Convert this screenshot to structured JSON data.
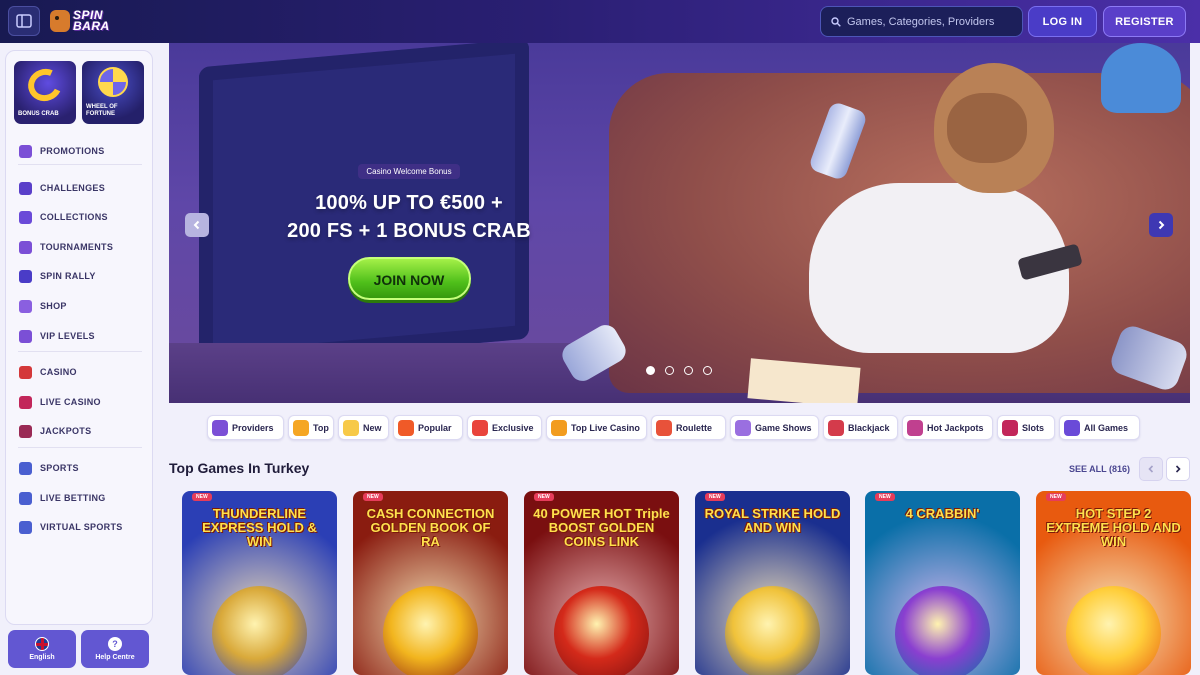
{
  "header": {
    "logo_text_1": "SPIN",
    "logo_text_2": "BARA",
    "search_placeholder": "Games, Categories, Providers",
    "login_label": "LOG IN",
    "register_label": "REGISTER"
  },
  "sidebar": {
    "tiles": [
      {
        "label": "BONUS CRAB"
      },
      {
        "label": "WHEEL OF FORTUNE"
      }
    ],
    "items": [
      {
        "label": "PROMOTIONS",
        "icon": "gift-icon"
      },
      {
        "label": "CHALLENGES",
        "icon": "trophy-icon"
      },
      {
        "label": "COLLECTIONS",
        "icon": "collection-icon"
      },
      {
        "label": "TOURNAMENTS",
        "icon": "tournament-icon"
      },
      {
        "label": "SPIN RALLY",
        "icon": "flag-icon"
      },
      {
        "label": "SHOP",
        "icon": "shop-icon"
      },
      {
        "label": "VIP LEVELS",
        "icon": "crown-icon"
      },
      {
        "label": "CASINO",
        "icon": "slot-icon"
      },
      {
        "label": "LIVE CASINO",
        "icon": "roulette-icon"
      },
      {
        "label": "JACKPOTS",
        "icon": "jackpot-icon"
      },
      {
        "label": "SPORTS",
        "icon": "ball-icon"
      },
      {
        "label": "LIVE BETTING",
        "icon": "live-icon"
      },
      {
        "label": "VIRTUAL SPORTS",
        "icon": "virtual-icon"
      }
    ],
    "language_label": "English",
    "help_label": "Help Centre"
  },
  "hero": {
    "badge": "Casino Welcome Bonus",
    "title_line1": "100% UP TO €500 +",
    "title_line2": "200 FS + 1 BONUS CRAB",
    "cta": "JOIN NOW",
    "slide_count": 4,
    "active_slide": 1
  },
  "categories": [
    {
      "label": "Providers",
      "color": "#7b4fd6"
    },
    {
      "label": "Top",
      "color": "#f5a623"
    },
    {
      "label": "New",
      "color": "#f7c948"
    },
    {
      "label": "Popular",
      "color": "#f05a28"
    },
    {
      "label": "Exclusive",
      "color": "#e9443c"
    },
    {
      "label": "Top Live Casino",
      "color": "#f29c1f"
    },
    {
      "label": "Roulette",
      "color": "#e8523a"
    },
    {
      "label": "Game Shows",
      "color": "#9a6fe0"
    },
    {
      "label": "Blackjack",
      "color": "#d43b4b"
    },
    {
      "label": "Hot Jackpots",
      "color": "#c0408f"
    },
    {
      "label": "Slots",
      "color": "#c2265a"
    },
    {
      "label": "All Games",
      "color": "#6a4ad8"
    }
  ],
  "section": {
    "title": "Top Games In Turkey",
    "see_all": "SEE ALL (816)"
  },
  "games": [
    {
      "title": "THUNDERLINE EXPRESS HOLD & WIN",
      "tag": "NEW",
      "bg": "#2b3fb5",
      "art": "#d9a93a"
    },
    {
      "title": "CASH CONNECTION GOLDEN BOOK OF RA",
      "tag": "NEW",
      "bg": "#8a1c10",
      "art": "#f2b51e"
    },
    {
      "title": "40 POWER HOT Triple BOOST GOLDEN COINS LINK",
      "tag": "NEW",
      "bg": "#7a0f10",
      "art": "#d42a1a"
    },
    {
      "title": "ROYAL STRIKE HOLD AND WIN",
      "tag": "NEW",
      "bg": "#1a2f8f",
      "art": "#f0c23a"
    },
    {
      "title": "4 CRABBIN'",
      "tag": "NEW",
      "bg": "#0a6fa8",
      "art": "#8a3fd0"
    },
    {
      "title": "HOT STEP 2 EXTREME HOLD AND WIN",
      "tag": "NEW",
      "bg": "#e85a0f",
      "art": "#ffce3a"
    }
  ]
}
